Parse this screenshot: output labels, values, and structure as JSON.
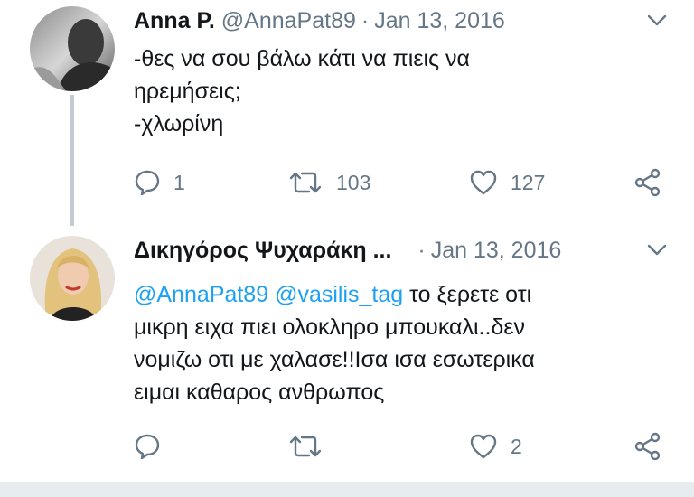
{
  "tweets": [
    {
      "author": "Anna P.",
      "handle": "@AnnaPat89",
      "separator": "·",
      "date": "Jan 13, 2016",
      "text_lines": [
        "-θες να σου βάλω κάτι να πιεις να",
        "ηρεμήσεις;",
        "-χλωρίνη"
      ],
      "replies": "1",
      "retweets": "103",
      "likes": "127"
    },
    {
      "author": "Δικηγόρος Ψυχαράκη ...",
      "handle": "",
      "separator": "·",
      "date": "Jan 13, 2016",
      "mentions": [
        "@AnnaPat89",
        "@vasilis_tag"
      ],
      "text_first_line_rest": " το ξερετε οτι",
      "text_lines": [
        "μικρη ειχα πιει ολοκληρο μπουκαλι..δεν",
        "νομιζω οτι με χαλασε!!Ισα ισα εσωτερικα",
        "ειμαι καθαρος ανθρωπος"
      ],
      "replies": "",
      "retweets": "",
      "likes": "2"
    }
  ],
  "icons": [
    "reply-icon",
    "retweet-icon",
    "like-icon",
    "share-icon",
    "chevron-down-icon"
  ],
  "colors": {
    "text": "#14171a",
    "secondary": "#657786",
    "link": "#1da1f2",
    "thread_line": "#c4ccd3",
    "divider": "#e6ecf0"
  }
}
